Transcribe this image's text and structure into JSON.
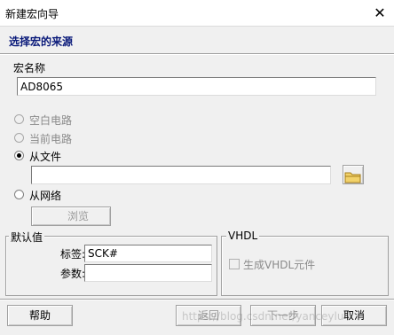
{
  "window": {
    "title": "新建宏向导"
  },
  "header": {
    "section_title": "选择宏的来源"
  },
  "macro_name": {
    "label": "宏名称",
    "value": "AD8065"
  },
  "sources": {
    "blank_circuit": "空白电路",
    "current_circuit": "当前电路",
    "from_file": "从文件",
    "file_path": "",
    "from_network": "从网络",
    "browse": "浏览"
  },
  "defaults": {
    "group_label": "默认值",
    "tag_label": "标签:",
    "tag_value": "SCK#",
    "param_label": "参数:",
    "param_value": ""
  },
  "vhdl": {
    "group_label": "VHDL",
    "generate_label": "生成VHDL元件"
  },
  "footer": {
    "help": "帮助",
    "back": "返回",
    "next": "下一步",
    "cancel": "取消",
    "watermark": "https://blog.csdn.net/yanceylu"
  }
}
